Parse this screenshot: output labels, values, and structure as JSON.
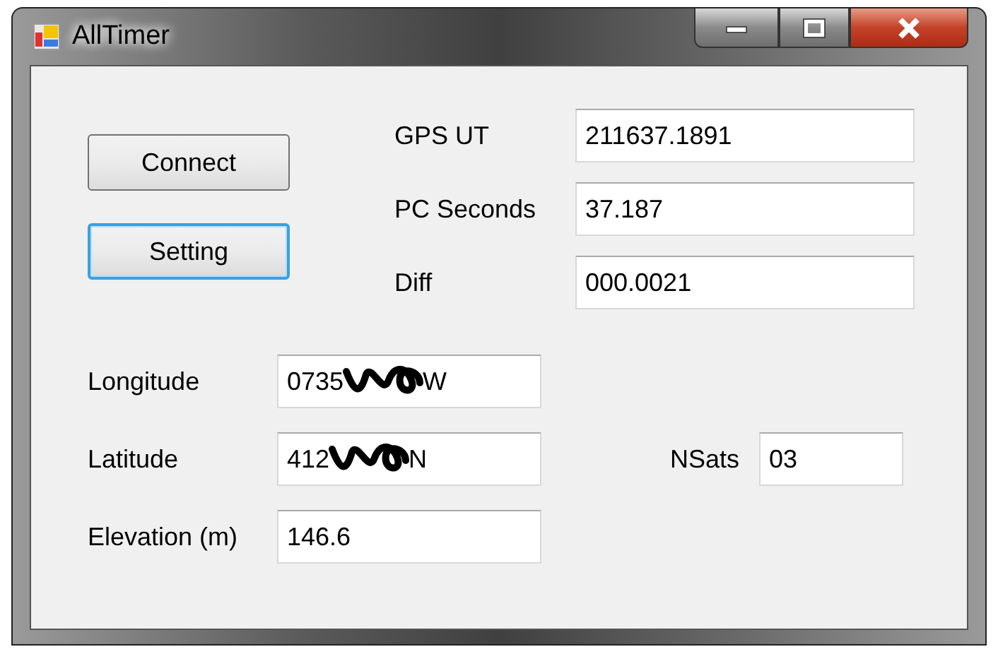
{
  "window": {
    "title": "AllTimer",
    "buttons": [
      {
        "kind": "minimize"
      },
      {
        "kind": "maximize"
      },
      {
        "kind": "close"
      }
    ]
  },
  "buttons": [
    {
      "label": "Connect",
      "focused": false
    },
    {
      "label": "Setting",
      "focused": true
    }
  ],
  "timing_fields": [
    {
      "label": "GPS UT",
      "value": "211637.1891"
    },
    {
      "label": "PC Seconds",
      "value": "37.187"
    },
    {
      "label": "Diff",
      "value": "000.0021"
    }
  ],
  "position_fields": [
    {
      "label": "Longitude",
      "value_start": "0735",
      "value_end": "W",
      "redacted": true
    },
    {
      "label": "Latitude",
      "value_start": "412",
      "value_end": "N",
      "redacted": true
    },
    {
      "label": "Elevation (m)",
      "value_start": "146.6",
      "redacted": false
    }
  ],
  "nsats": {
    "label": "NSats",
    "value": "03"
  }
}
